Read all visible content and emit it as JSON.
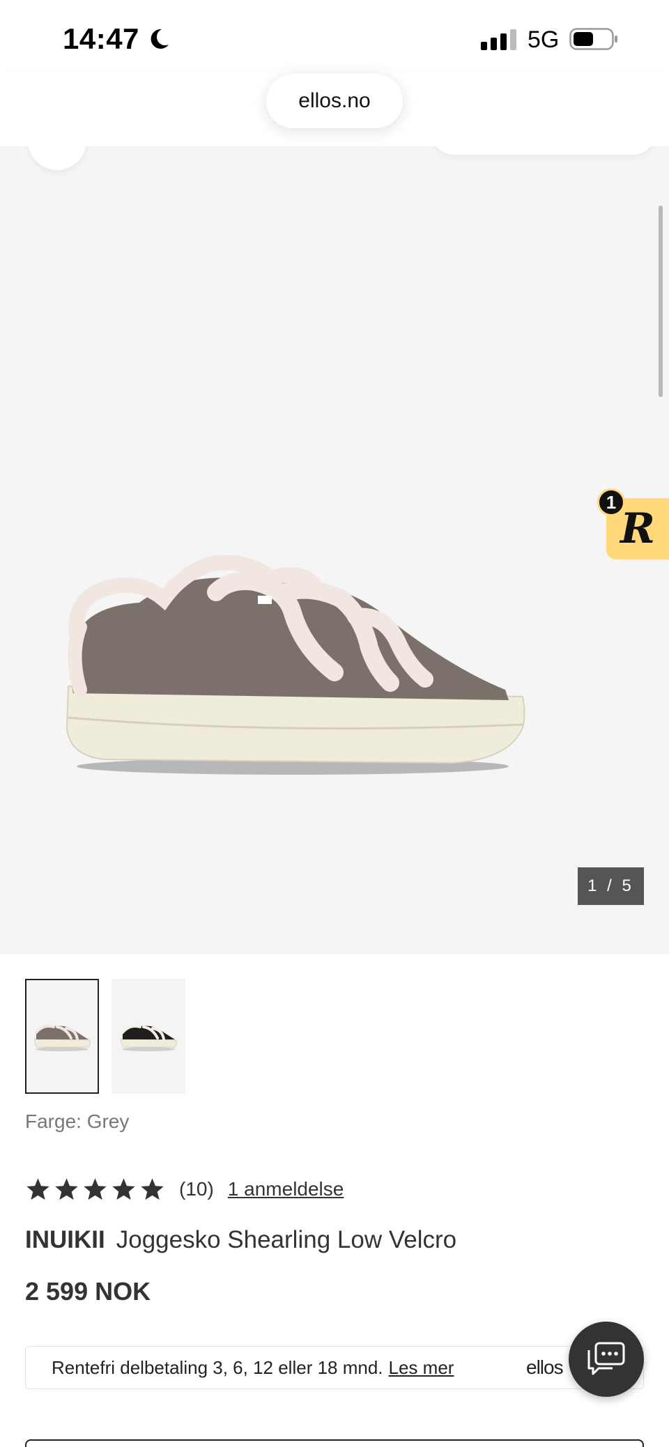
{
  "status_bar": {
    "time": "14:47",
    "network": "5G",
    "icons": [
      "moon-icon",
      "signal-icon",
      "battery-icon"
    ]
  },
  "browser": {
    "url": "ellos.no"
  },
  "gallery": {
    "counter": "1 / 5",
    "current_image": 1,
    "total_images": 5
  },
  "widget": {
    "badge_count": "1",
    "letter": "R",
    "color": "#ffd97a"
  },
  "thumbnails": [
    {
      "name": "thumb-grey",
      "selected": true
    },
    {
      "name": "thumb-black",
      "selected": false
    }
  ],
  "product": {
    "color_label": "Farge: Grey",
    "rating_stars": 5,
    "rating_count": "(10)",
    "review_link": "1 anmeldelse",
    "brand": "INUIKII",
    "name": "Joggesko Shearling Low Velcro",
    "price": "2 599 NOK"
  },
  "financing": {
    "text": "Rentefri delbetaling 3, 6, 12 eller 18 mnd.",
    "link": "Les mer",
    "logo": "ellos"
  },
  "colors": {
    "gallery_bg": "#f5f5f5",
    "text": "#333333",
    "chat_button": "#333333"
  }
}
